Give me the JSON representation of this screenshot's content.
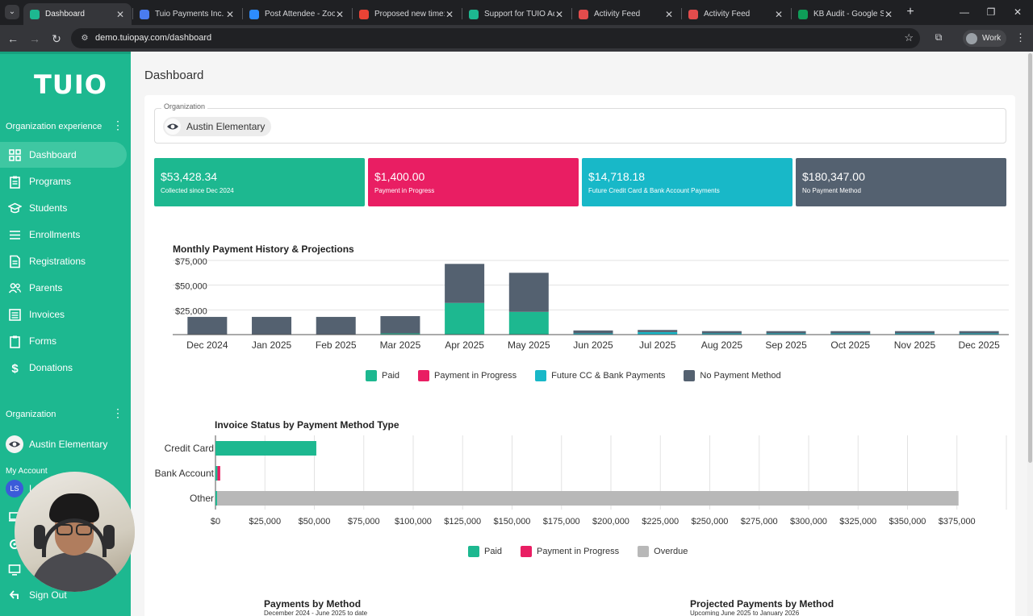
{
  "browser": {
    "tabs": [
      {
        "title": "Dashboard",
        "color": "#1db890"
      },
      {
        "title": "Tuio Payments Inc. -",
        "color": "#4a7cf0"
      },
      {
        "title": "Post Attendee - Zoo",
        "color": "#2d8cff"
      },
      {
        "title": "Proposed new time:",
        "color": "#ea4335"
      },
      {
        "title": "Support for TUIO Ad",
        "color": "#1db890"
      },
      {
        "title": "Activity Feed",
        "color": "#e34c4c"
      },
      {
        "title": "Activity Feed",
        "color": "#e34c4c"
      },
      {
        "title": "KB Audit - Google Sh",
        "color": "#0f9d58"
      }
    ],
    "url": "demo.tuiopay.com/dashboard",
    "profile_label": "Work"
  },
  "sidebar": {
    "logo": "TUIO",
    "section_label": "Organization experience",
    "items": [
      {
        "label": "Dashboard",
        "icon": "grid-icon",
        "active": true
      },
      {
        "label": "Programs",
        "icon": "clipboard-icon"
      },
      {
        "label": "Students",
        "icon": "graduation-cap-icon"
      },
      {
        "label": "Enrollments",
        "icon": "list-icon"
      },
      {
        "label": "Registrations",
        "icon": "document-icon"
      },
      {
        "label": "Parents",
        "icon": "people-icon"
      },
      {
        "label": "Invoices",
        "icon": "invoice-icon"
      },
      {
        "label": "Forms",
        "icon": "form-icon"
      },
      {
        "label": "Donations",
        "icon": "dollar-icon"
      }
    ],
    "org_section_label": "Organization",
    "org_name": "Austin Elementary",
    "my_account_label": "My Account",
    "user_initials": "LS",
    "user_name_partial": "Le",
    "sign_out_label": "Sign Out"
  },
  "main": {
    "page_title": "Dashboard",
    "organization_field_label": "Organization",
    "organization_value": "Austin Elementary",
    "stats": [
      {
        "value": "$53,428.34",
        "label": "Collected since Dec 2024",
        "color": "#1db890"
      },
      {
        "value": "$1,400.00",
        "label": "Payment in Progress",
        "color": "#e91e63"
      },
      {
        "value": "$14,718.18",
        "label": "Future Credit Card & Bank Account Payments",
        "color": "#18b8c8"
      },
      {
        "value": "$180,347.00",
        "label": "No Payment Method",
        "color": "#546170"
      }
    ],
    "payments_by_method_title": "Payments by Method",
    "payments_by_method_subtitle": "December 2024 - June 2025 to date",
    "projected_title": "Projected Payments by Method",
    "projected_subtitle": "Upcoming June 2025 to January 2026"
  },
  "chart_data": [
    {
      "type": "bar",
      "stacked": true,
      "title": "Monthly Payment History & Projections",
      "categories": [
        "Dec 2024",
        "Jan 2025",
        "Feb 2025",
        "Mar 2025",
        "Apr 2025",
        "May 2025",
        "Jun 2025",
        "Jul 2025",
        "Aug 2025",
        "Sep 2025",
        "Oct 2025",
        "Nov 2025",
        "Dec 2025"
      ],
      "y_ticks": [
        "$25,000",
        "$50,000",
        "$75,000"
      ],
      "ylim": [
        0,
        75000
      ],
      "series": [
        {
          "name": "Paid",
          "color": "#1db890",
          "values": [
            400,
            400,
            400,
            1200,
            32000,
            23000,
            0,
            0,
            0,
            0,
            0,
            0,
            0
          ]
        },
        {
          "name": "Payment in Progress",
          "color": "#e91e63",
          "values": [
            0,
            0,
            0,
            0,
            0,
            0,
            0,
            0,
            0,
            0,
            0,
            0,
            0
          ]
        },
        {
          "name": "Future CC & Bank Payments",
          "color": "#18b8c8",
          "values": [
            0,
            0,
            0,
            0,
            0,
            0,
            1200,
            2500,
            1200,
            1200,
            1200,
            1200,
            1200
          ]
        },
        {
          "name": "No Payment Method",
          "color": "#546170",
          "values": [
            17500,
            17500,
            17500,
            17500,
            39500,
            39500,
            3000,
            2200,
            2300,
            2300,
            2300,
            2300,
            2300
          ]
        }
      ],
      "legend_position": "bottom",
      "grid": true
    },
    {
      "type": "bar",
      "orientation": "horizontal",
      "stacked": true,
      "title": "Invoice Status by Payment Method Type",
      "categories": [
        "Credit Card",
        "Bank Account",
        "Other"
      ],
      "x_ticks": [
        "$0",
        "$25,000",
        "$50,000",
        "$75,000",
        "$100,000",
        "$125,000",
        "$150,000",
        "$175,000",
        "$200,000",
        "$225,000",
        "$250,000",
        "$275,000",
        "$300,000",
        "$325,000",
        "$350,000",
        "$375,000"
      ],
      "xlim": [
        0,
        400000
      ],
      "series": [
        {
          "name": "Paid",
          "color": "#1db890",
          "values": [
            51000,
            1000,
            800
          ]
        },
        {
          "name": "Payment in Progress",
          "color": "#e91e63",
          "values": [
            0,
            1400,
            0
          ]
        },
        {
          "name": "Overdue",
          "color": "#b8b8b8",
          "values": [
            0,
            0,
            375000
          ]
        }
      ],
      "legend_position": "bottom",
      "grid": true
    }
  ]
}
